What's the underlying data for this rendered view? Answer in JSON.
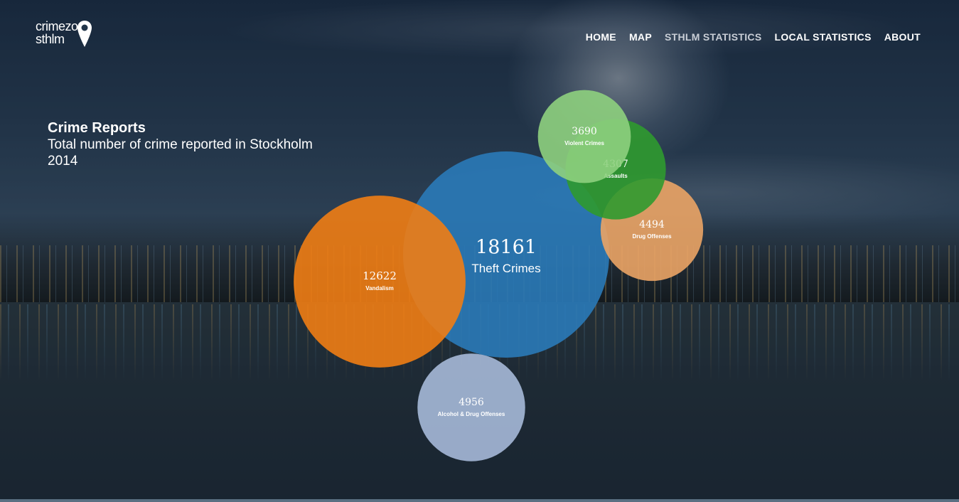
{
  "logo": {
    "line1": "crimezone",
    "line2": "sthlm"
  },
  "nav": {
    "items": [
      {
        "label": "HOME",
        "active": false
      },
      {
        "label": "MAP",
        "active": false
      },
      {
        "label": "STHLM STATISTICS",
        "active": true
      },
      {
        "label": "LOCAL STATISTICS",
        "active": false
      },
      {
        "label": "ABOUT",
        "active": false
      }
    ]
  },
  "report": {
    "title": "Crime Reports",
    "subtitle": "Total number of crime reported in Stockholm",
    "year": "2014"
  },
  "chart_data": {
    "type": "bubble",
    "title": "Crime Reports",
    "series": [
      {
        "name": "Theft Crimes",
        "value": 18161,
        "color": "#2a7ab8"
      },
      {
        "name": "Vandalism",
        "value": 12622,
        "color": "#f07d14"
      },
      {
        "name": "Alcohol & Drug Offenses",
        "value": 4956,
        "color": "#a6b9d8"
      },
      {
        "name": "Drug Offenses",
        "value": 4494,
        "color": "#eba465"
      },
      {
        "name": "Assaults",
        "value": 4307,
        "color": "#2f9a2f"
      },
      {
        "name": "Violent Crimes",
        "value": 3690,
        "color": "#8ed07e"
      }
    ]
  }
}
